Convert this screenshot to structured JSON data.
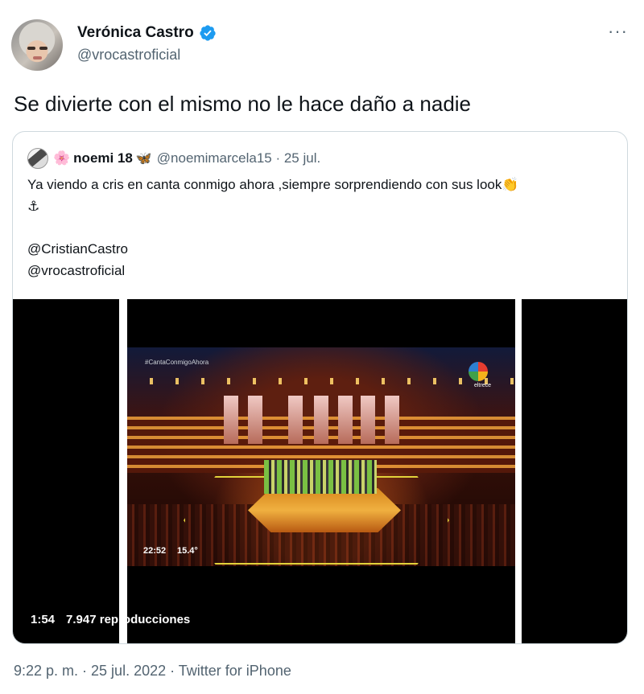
{
  "author": {
    "display_name": "Verónica Castro",
    "handle": "@vrocastroficial",
    "avatar_icon": "profile-photo",
    "verified": true
  },
  "more_icon": "···",
  "tweet": {
    "text": "Se divierte con el mismo no le hace daño a nadie"
  },
  "quoted": {
    "flower_emoji": "🌸",
    "name": "noemi 18",
    "butterfly_emoji": "🦋",
    "handle_meta": "@noemimarcela15 · 25 jul.",
    "line1": "Ya viendo a cris en canta conmigo ahora ,siempre sorprendiendo con sus look",
    "clap_emoji": "👏",
    "line2": "⚓",
    "mention1": "@CristianCastro",
    "mention2": "@vrocastroficial",
    "video": {
      "hashtag": "#CantaConmigoAhora",
      "channel": "eltrece",
      "clock": "22:52",
      "temperature": "15.4°",
      "duration": "1:54",
      "views": "7.947 reproducciones"
    }
  },
  "footer": "9:22 p. m. · 25 jul. 2022 · Twitter for iPhone",
  "colors": {
    "verified_blue": "#1d9bf0",
    "secondary_text": "#536471",
    "border": "#cfd9de"
  }
}
